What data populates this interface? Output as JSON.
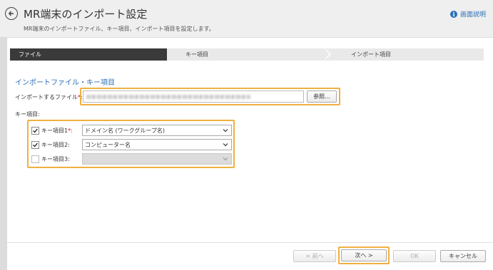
{
  "header": {
    "title": "MR端末のインポート設定",
    "subtitle": "MR端末のインポートファイル、キー項目、インポート項目を設定します。",
    "help_label": "画面説明"
  },
  "steps": [
    "ファイル",
    "キー項目",
    "インポート項目"
  ],
  "section_title": "インポートファイル・キー項目",
  "file": {
    "label": "インポートするファイル",
    "required_mark": "*:",
    "browse_label": "参照..."
  },
  "keys": {
    "label": "キー項目:",
    "items": [
      {
        "label": "キー項目1",
        "required_mark": "*:",
        "checked": true,
        "value": "ドメイン名 (ワークグループ名)"
      },
      {
        "label": "キー項目2:",
        "required_mark": "",
        "checked": true,
        "value": "コンピューター名"
      },
      {
        "label": "キー項目3:",
        "required_mark": "",
        "checked": false,
        "value": ""
      }
    ]
  },
  "footer": {
    "prev_label": "< 前へ",
    "next_label": "次へ >",
    "ok_label": "OK",
    "cancel_label": "キャンセル"
  },
  "colors": {
    "accent": "#2a6fb5",
    "highlight": "#f0b040",
    "step_active": "#3a3a3a"
  }
}
